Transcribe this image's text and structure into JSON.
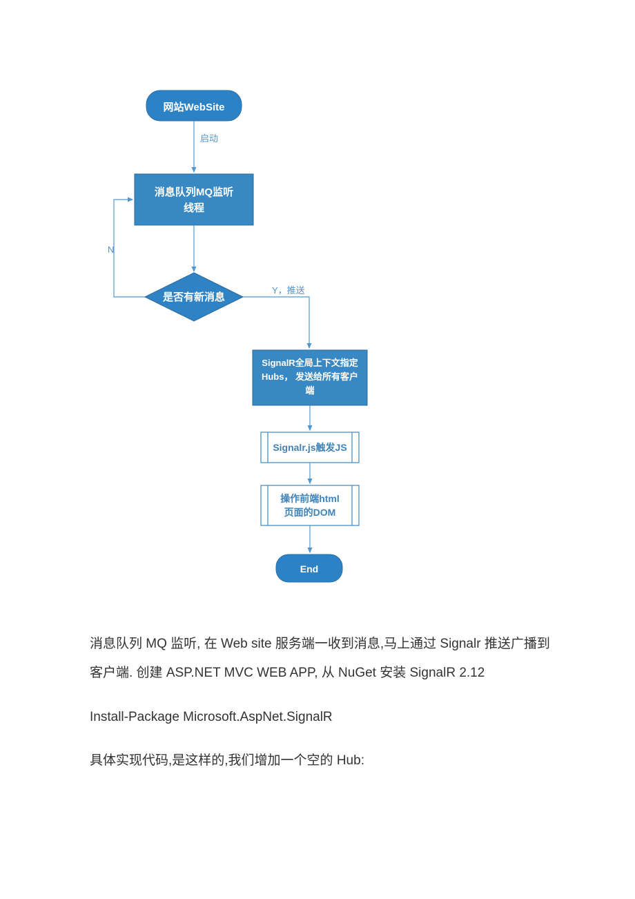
{
  "flow": {
    "start": "网站WebSite",
    "edge_start": "启动",
    "mq_listener_l1": "消息队列MQ监听",
    "mq_listener_l2": "线程",
    "no_label": "N",
    "decision": "是否有新消息",
    "yes_label": "Y，推送",
    "signalr_ctx_l1": "SignalR全局上下文指定",
    "signalr_ctx_l2": "Hubs， 发送给所有客户",
    "signalr_ctx_l3": "端",
    "signalr_js": "Signalr.js触发JS",
    "dom_l1": "操作前端html",
    "dom_l2": "页面的DOM",
    "end": "End"
  },
  "paragraphs": {
    "p1": "消息队列 MQ 监听,  在 Web site  服务端一收到消息,马上通过 Signalr  推送广播到客户端.   创建 ASP.NET MVC WEB APP,   从 NuGet  安装 SignalR 2.12",
    "p2": "Install-Package Microsoft.AspNet.SignalR",
    "p3": "具体实现代码,是这样的,我们增加一个空的 Hub:"
  }
}
